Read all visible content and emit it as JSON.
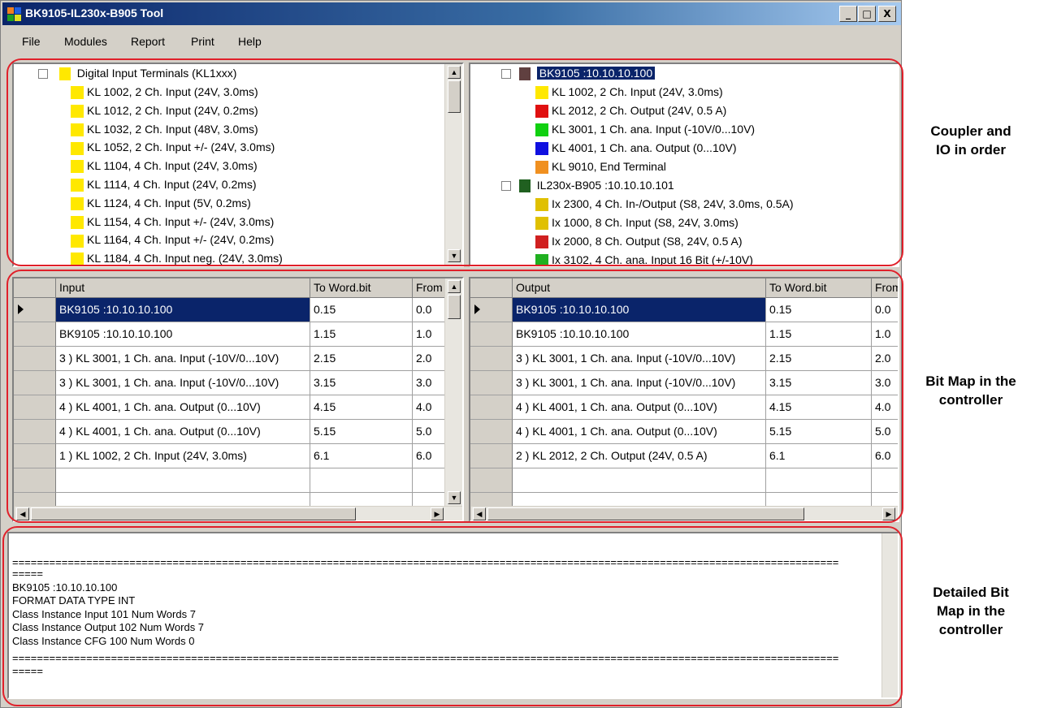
{
  "window": {
    "title": "BK9105-IL230x-B905 Tool"
  },
  "titlebar_buttons": [
    "_",
    "□",
    "X"
  ],
  "menu": [
    "File",
    "Modules",
    "Report",
    "Print",
    "Help"
  ],
  "catalog_tree": {
    "group_label": "Digital Input Terminals (KL1xxx)",
    "items": [
      "KL 1002, 2 Ch. Input (24V, 3.0ms)",
      "KL 1012, 2 Ch. Input (24V, 0.2ms)",
      "KL 1032, 2 Ch. Input (48V, 3.0ms)",
      "KL 1052, 2 Ch. Input +/- (24V, 3.0ms)",
      "KL 1104, 4 Ch. Input (24V, 3.0ms)",
      "KL 1114, 4 Ch. Input (24V, 0.2ms)",
      "KL 1124, 4 Ch. Input (5V, 0.2ms)",
      "KL 1154, 4 Ch. Input +/- (24V, 3.0ms)",
      "KL 1164, 4 Ch. Input +/- (24V, 0.2ms)",
      "KL 1184, 4 Ch. Input neg. (24V, 3.0ms)"
    ]
  },
  "config_tree": {
    "coupler1": "BK9105 :10.10.10.100",
    "coupler1_items": [
      {
        "label": "KL 1002, 2 Ch. Input (24V, 3.0ms)",
        "color": "#ffe800"
      },
      {
        "label": "KL 2012, 2 Ch. Output (24V, 0.5 A)",
        "color": "#e01010"
      },
      {
        "label": "KL 3001, 1 Ch. ana. Input (-10V/0...10V)",
        "color": "#10d010"
      },
      {
        "label": "KL 4001, 1 Ch. ana. Output (0...10V)",
        "color": "#1010e0"
      },
      {
        "label": "KL 9010, End Terminal",
        "color": "#f09020"
      }
    ],
    "coupler2": "IL230x-B905 :10.10.10.101",
    "coupler2_items": [
      {
        "label": "Ix 2300, 4 Ch. In-/Output (S8, 24V, 3.0ms, 0.5A)",
        "color": "#e0c000"
      },
      {
        "label": "Ix 1000, 8 Ch. Input (S8, 24V, 3.0ms)",
        "color": "#e0c000"
      },
      {
        "label": "Ix 2000, 8 Ch. Output (S8, 24V, 0.5 A)",
        "color": "#d02020"
      },
      {
        "label": "Ix 3102, 4 Ch. ana. Input 16 Bit (+/-10V)",
        "color": "#20b020"
      }
    ]
  },
  "input_grid": {
    "headers": [
      "Input",
      "To Word.bit",
      "From"
    ],
    "rows": [
      [
        "BK9105 :10.10.10.100",
        "0.15",
        "0.0"
      ],
      [
        "BK9105 :10.10.10.100",
        "1.15",
        "1.0"
      ],
      [
        "3 ) KL 3001, 1 Ch. ana. Input (-10V/0...10V)",
        "2.15",
        "2.0"
      ],
      [
        "3 ) KL 3001, 1 Ch. ana. Input (-10V/0...10V)",
        "3.15",
        "3.0"
      ],
      [
        "4 ) KL 4001, 1 Ch. ana. Output (0...10V)",
        "4.15",
        "4.0"
      ],
      [
        "4 ) KL 4001, 1 Ch. ana. Output (0...10V)",
        "5.15",
        "5.0"
      ],
      [
        "1 ) KL 1002, 2 Ch. Input (24V, 3.0ms)",
        "6.1",
        "6.0"
      ]
    ]
  },
  "output_grid": {
    "headers": [
      "Output",
      "To Word.bit",
      "From"
    ],
    "rows": [
      [
        "BK9105 :10.10.10.100",
        "0.15",
        "0.0"
      ],
      [
        "BK9105 :10.10.10.100",
        "1.15",
        "1.0"
      ],
      [
        "3 ) KL 3001, 1 Ch. ana. Input (-10V/0...10V)",
        "2.15",
        "2.0"
      ],
      [
        "3 ) KL 3001, 1 Ch. ana. Input (-10V/0...10V)",
        "3.15",
        "3.0"
      ],
      [
        "4 ) KL 4001, 1 Ch. ana. Output (0...10V)",
        "4.15",
        "4.0"
      ],
      [
        "4 ) KL 4001, 1 Ch. ana. Output (0...10V)",
        "5.15",
        "5.0"
      ],
      [
        "2 ) KL 2012, 2 Ch. Output (24V, 0.5 A)",
        "6.1",
        "6.0"
      ]
    ]
  },
  "log": {
    "separator": "======================================================================================================================================",
    "lines": [
      "=====",
      "BK9105 :10.10.10.100",
      "FORMAT DATA TYPE INT",
      "Class Instance Input   101  Num Words 7",
      "Class Instance Output  102  Num Words 7",
      "Class Instance CFG     100  Num Words 0"
    ],
    "tail": "====="
  },
  "annotations": {
    "a1": [
      "Coupler and",
      "IO in order"
    ],
    "a2": [
      "Bit Map in the",
      "controller"
    ],
    "a3": [
      "Detailed Bit",
      "Map in the",
      "controller"
    ]
  },
  "colors": {
    "selection": "#0a246a",
    "outline": "#e0202a"
  }
}
